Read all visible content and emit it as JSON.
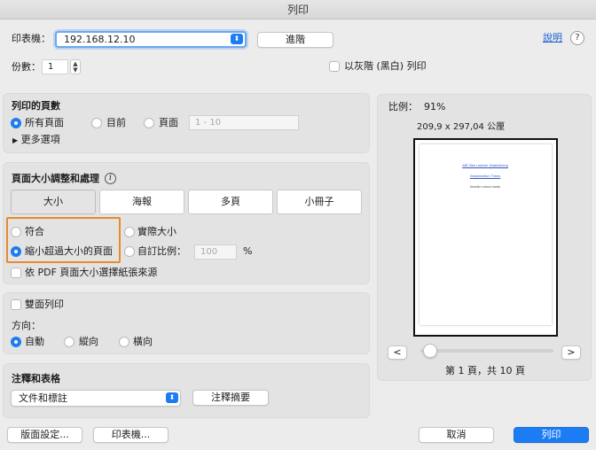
{
  "window": {
    "title": "列印"
  },
  "printer": {
    "label": "印表機：",
    "value": "192.168.12.10",
    "advanced_button": "進階",
    "help_link": "說明",
    "help_icon": "?"
  },
  "copies": {
    "label": "份數：",
    "value": "1",
    "grayscale_label": "以灰階 (黑白) 列印"
  },
  "pages": {
    "heading": "列印的頁數",
    "options": [
      "所有頁面",
      "目前",
      "頁面"
    ],
    "selected": "所有頁面",
    "range_placeholder": "1 - 10",
    "more_options": "更多選項"
  },
  "sizing": {
    "heading": "頁面大小調整和處理",
    "info_icon": "i",
    "tabs": [
      "大小",
      "海報",
      "多頁",
      "小冊子"
    ],
    "active_tab": "大小",
    "fit": "符合",
    "actual_size": "實際大小",
    "shrink_oversized": "縮小超過大小的頁面",
    "custom_scale": "自訂比例：",
    "custom_scale_value": "100",
    "percent": "%",
    "pdf_paper_source": "依 PDF 頁面大小選擇紙張來源",
    "selected": "縮小超過大小的頁面"
  },
  "duplex": {
    "label": "雙面列印",
    "orientation_label": "方向：",
    "orientations": [
      "自動",
      "縱向",
      "橫向"
    ],
    "selected": "自動"
  },
  "comments": {
    "heading": "注釋和表格",
    "select_value": "文件和標註",
    "summary_button": "注釋摘要"
  },
  "preview": {
    "scale_label": "比例：",
    "scale_value": "91%",
    "page_size": "209,9 x 297,04 公厘",
    "prev_button": "<",
    "next_button": ">",
    "page_indicator": "第 1 頁，共 10 頁",
    "page_position": 0.0,
    "thumbnail_lines": [
      "ABC Bee Leather Establishing",
      "Globalization Times",
      "header colour body"
    ]
  },
  "footer": {
    "page_setup": "版面設定...",
    "printer_button": "印表機...",
    "cancel": "取消",
    "print": "列印"
  },
  "colors": {
    "accent": "#1b7cf3",
    "highlight": "#e8892e",
    "link": "#1b5fd0"
  }
}
